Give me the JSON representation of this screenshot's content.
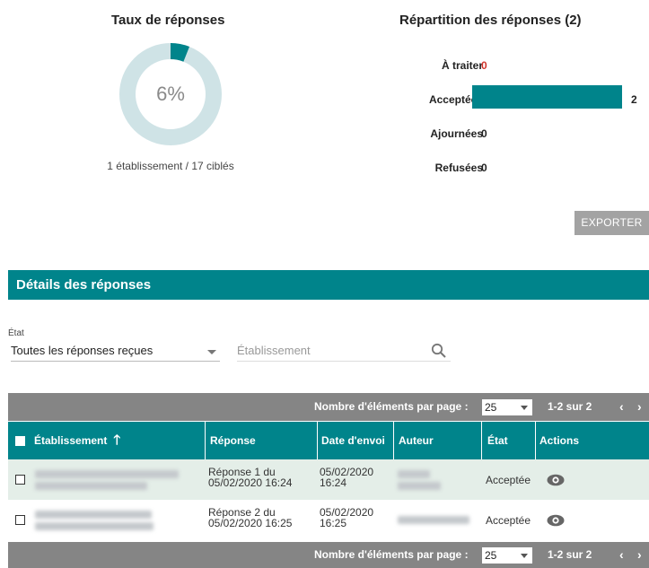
{
  "taux": {
    "title": "Taux de réponses",
    "percent_label": "6%",
    "percent": 0.06,
    "caption": "1 établissement / 17 ciblés",
    "ring_color": "#cfe3e6",
    "fill_color": "#00848b"
  },
  "repartition": {
    "title": "Répartition des réponses (2)",
    "rows": [
      {
        "label": "À traiter",
        "value": "0",
        "count": 0,
        "value_color": "#d0342c"
      },
      {
        "label": "Acceptées",
        "value": "2",
        "count": 2,
        "value_color": "#222222"
      },
      {
        "label": "Ajournées",
        "value": "0",
        "count": 0,
        "value_color": "#222222"
      },
      {
        "label": "Refusées",
        "value": "0",
        "count": 0,
        "value_color": "#222222"
      }
    ],
    "max": 2,
    "bar_color": "#00848b"
  },
  "export_label": "EXPORTER",
  "details": {
    "title": "Détails des réponses",
    "filter_label": "État",
    "state_select": "Toutes les réponses reçues",
    "search_placeholder": "Établissement"
  },
  "pager": {
    "label": "Nombre d'éléments par page :",
    "page_size": "25",
    "range": "1-2 sur 2",
    "prev": "‹",
    "next": "›"
  },
  "table": {
    "columns": [
      "Établissement",
      "Réponse",
      "Date d'envoi",
      "Auteur",
      "État",
      "Actions"
    ],
    "rows": [
      {
        "reponse_line1": "Réponse 1 du",
        "reponse_line2": "05/02/2020 16:24",
        "date_line1": "05/02/2020",
        "date_line2": "16:24",
        "etat": "Acceptée"
      },
      {
        "reponse_line1": "Réponse 2 du",
        "reponse_line2": "05/02/2020 16:25",
        "date_line1": "05/02/2020",
        "date_line2": "16:25",
        "etat": "Acceptée"
      }
    ]
  }
}
